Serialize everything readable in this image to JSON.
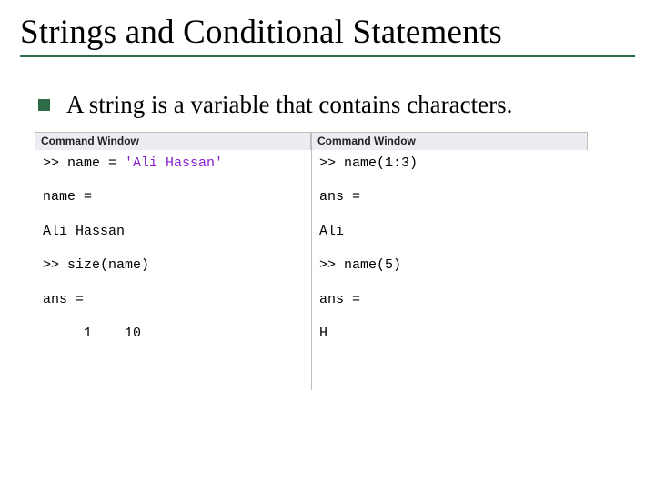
{
  "title": "Strings and Conditional Statements",
  "bullet_text": "A string is a variable that contains characters.",
  "left_panel": {
    "header": "Command Window",
    "lines": {
      "l0a": ">> name = ",
      "l0b": "'Ali Hassan'",
      "l1": "",
      "l2": "name =",
      "l3": "",
      "l4": "Ali Hassan",
      "l5": "",
      "l6": ">> size(name)",
      "l7": "",
      "l8": "ans =",
      "l9": "",
      "l10": "     1    10"
    }
  },
  "right_panel": {
    "header": "Command Window",
    "lines": {
      "r0": ">> name(1:3)",
      "r1": "",
      "r2": "ans =",
      "r3": "",
      "r4": "Ali",
      "r5": "",
      "r6": ">> name(5)",
      "r7": "",
      "r8": "ans =",
      "r9": "",
      "r10": "H"
    }
  }
}
